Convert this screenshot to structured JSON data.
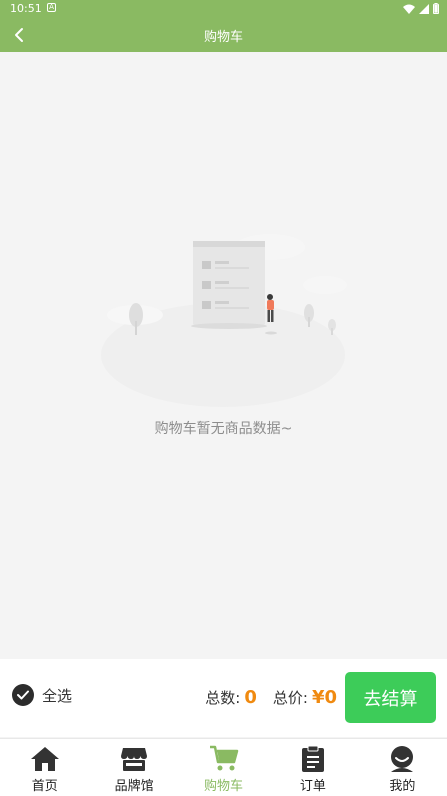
{
  "status_bar": {
    "time": "10:51",
    "app_badge": "A"
  },
  "header": {
    "title": "购物车"
  },
  "empty_state": {
    "message": "购物车暂无商品数据~"
  },
  "checkout": {
    "select_all_label": "全选",
    "count_label": "总数:",
    "count_value": "0",
    "price_label": "总价:",
    "price_value": "¥0",
    "pay_button": "去结算"
  },
  "tabs": [
    {
      "label": "首页",
      "icon": "home-icon"
    },
    {
      "label": "品牌馆",
      "icon": "store-icon"
    },
    {
      "label": "购物车",
      "icon": "cart-icon",
      "active": true
    },
    {
      "label": "订单",
      "icon": "order-icon"
    },
    {
      "label": "我的",
      "icon": "profile-icon"
    }
  ],
  "colors": {
    "brand_green": "#8aba62",
    "pay_green": "#3dcc59",
    "accent_orange": "#f08a10"
  }
}
